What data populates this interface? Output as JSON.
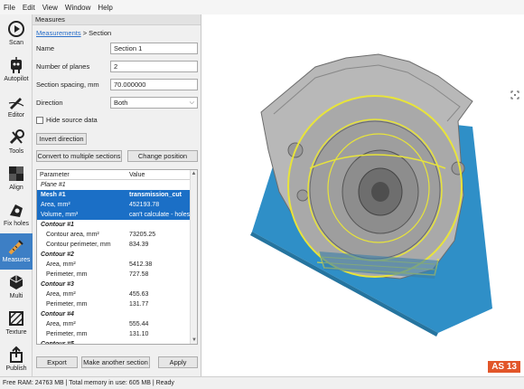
{
  "menu": [
    "File",
    "Edit",
    "View",
    "Window",
    "Help"
  ],
  "tools": [
    {
      "label": "Scan",
      "icon": "scan-icon"
    },
    {
      "label": "Autopilot",
      "icon": "autopilot-icon"
    },
    {
      "label": "Editor",
      "icon": "editor-icon"
    },
    {
      "label": "Tools",
      "icon": "tools-icon"
    },
    {
      "label": "Align",
      "icon": "align-icon"
    },
    {
      "label": "Fix holes",
      "icon": "fix-holes-icon"
    },
    {
      "label": "Measures",
      "icon": "measures-icon"
    },
    {
      "label": "Multi",
      "icon": "multi-icon"
    },
    {
      "label": "Texture",
      "icon": "texture-icon"
    },
    {
      "label": "Publish",
      "icon": "publish-icon"
    }
  ],
  "panel": {
    "title": "Measures",
    "breadcrumb_link": "Measurements",
    "breadcrumb_rest": " > Section",
    "name_label": "Name",
    "name_value": "Section 1",
    "planes_label": "Number of planes",
    "planes_value": "2",
    "spacing_label": "Section spacing, mm",
    "spacing_value": "70.000000",
    "direction_label": "Direction",
    "direction_value": "Both",
    "hide_label": "Hide source data",
    "invert_button": "Invert direction",
    "convert_button": "Convert to multiple sections",
    "change_button": "Change position",
    "export_button": "Export",
    "another_button": "Make another section",
    "apply_button": "Apply"
  },
  "table": {
    "headers": [
      "Parameter",
      "Value"
    ],
    "rows": [
      {
        "p": "Plane #1",
        "v": "",
        "kind": "plane"
      },
      {
        "p": "Mesh #1",
        "v": "transmission_cut",
        "kind": "sel-bold"
      },
      {
        "p": "Area, mm²",
        "v": "452193.78",
        "kind": "sel"
      },
      {
        "p": "Volume, mm³",
        "v": "can't calculate - holes in",
        "kind": "sel"
      },
      {
        "p": "Contour #1",
        "v": "",
        "kind": "group"
      },
      {
        "p": "Contour area, mm²",
        "v": "73205.25",
        "kind": "ind"
      },
      {
        "p": "Contour perimeter, mm",
        "v": "834.39",
        "kind": "ind"
      },
      {
        "p": "Contour #2",
        "v": "",
        "kind": "group"
      },
      {
        "p": "Area, mm²",
        "v": "5412.38",
        "kind": "ind"
      },
      {
        "p": "Perimeter, mm",
        "v": "727.58",
        "kind": "ind"
      },
      {
        "p": "Contour #3",
        "v": "",
        "kind": "group"
      },
      {
        "p": "Area, mm²",
        "v": "455.63",
        "kind": "ind"
      },
      {
        "p": "Perimeter, mm",
        "v": "131.77",
        "kind": "ind"
      },
      {
        "p": "Contour #4",
        "v": "",
        "kind": "group"
      },
      {
        "p": "Area, mm²",
        "v": "555.44",
        "kind": "ind"
      },
      {
        "p": "Perimeter, mm",
        "v": "131.10",
        "kind": "ind"
      },
      {
        "p": "Contour #5",
        "v": "",
        "kind": "group"
      }
    ]
  },
  "badge": "AS 13",
  "status": "Free RAM: 24763 MB  |  Total memory in use: 605 MB  |  Ready",
  "colors": {
    "accent": "#3d7fc5",
    "selection": "#1b6fc6",
    "plane": "#2f8fc7",
    "contour": "#e8e43a",
    "badge": "#e2562a"
  }
}
